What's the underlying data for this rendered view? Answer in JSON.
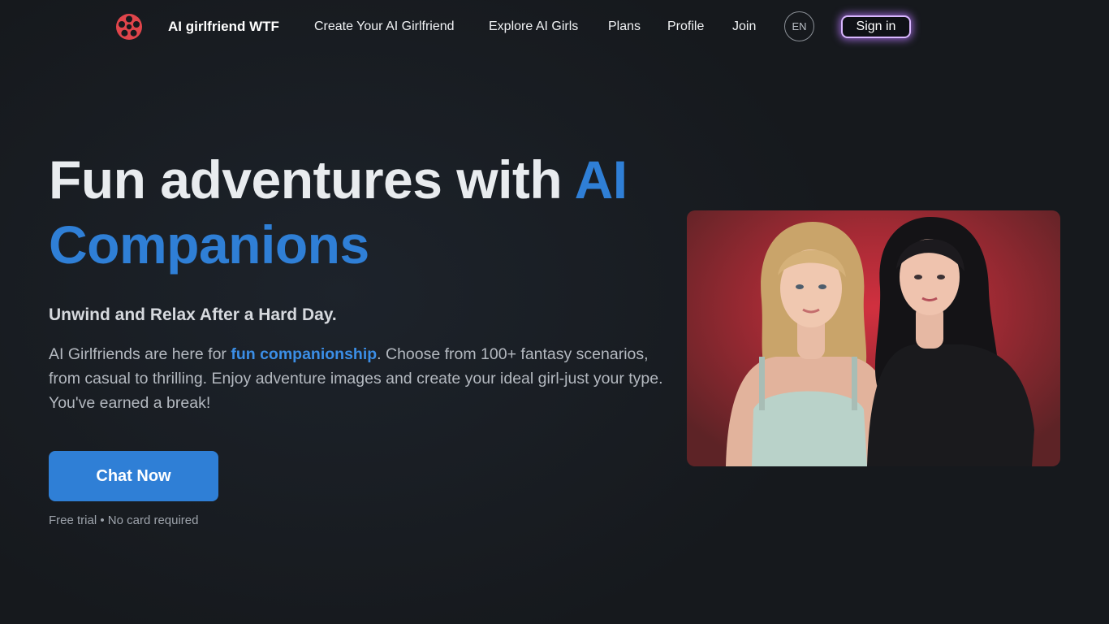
{
  "nav": {
    "logo_icon": "film-reel-logo-icon",
    "brand": "AI girlfriend WTF",
    "links": [
      {
        "label": "Create Your AI Girlfriend"
      },
      {
        "label": "Explore AI Girls"
      },
      {
        "label": "Plans"
      },
      {
        "label": "Profile"
      },
      {
        "label": "Join"
      }
    ],
    "language": "EN",
    "signin_label": "Sign in"
  },
  "hero": {
    "headline_main": "Fun adventures with ",
    "headline_accent": "AI Companions",
    "subheadline": "Unwind and Relax After a Hard Day.",
    "body_before": "AI Girlfriends are here for ",
    "body_link": "fun companionship",
    "body_after": ". Choose from 100+ fantasy scenarios, from casual to thrilling. Enjoy adventure images and create your ideal girl-just your type. You've earned a break!",
    "cta_label": "Chat Now",
    "fine_print": "Free trial • No card required",
    "image_subject": "two-women-photo"
  },
  "colors": {
    "background": "#16191d",
    "accent": "#2f7fd6",
    "signin_glow": "#ba78ff",
    "image_background": "#c82e3b"
  }
}
